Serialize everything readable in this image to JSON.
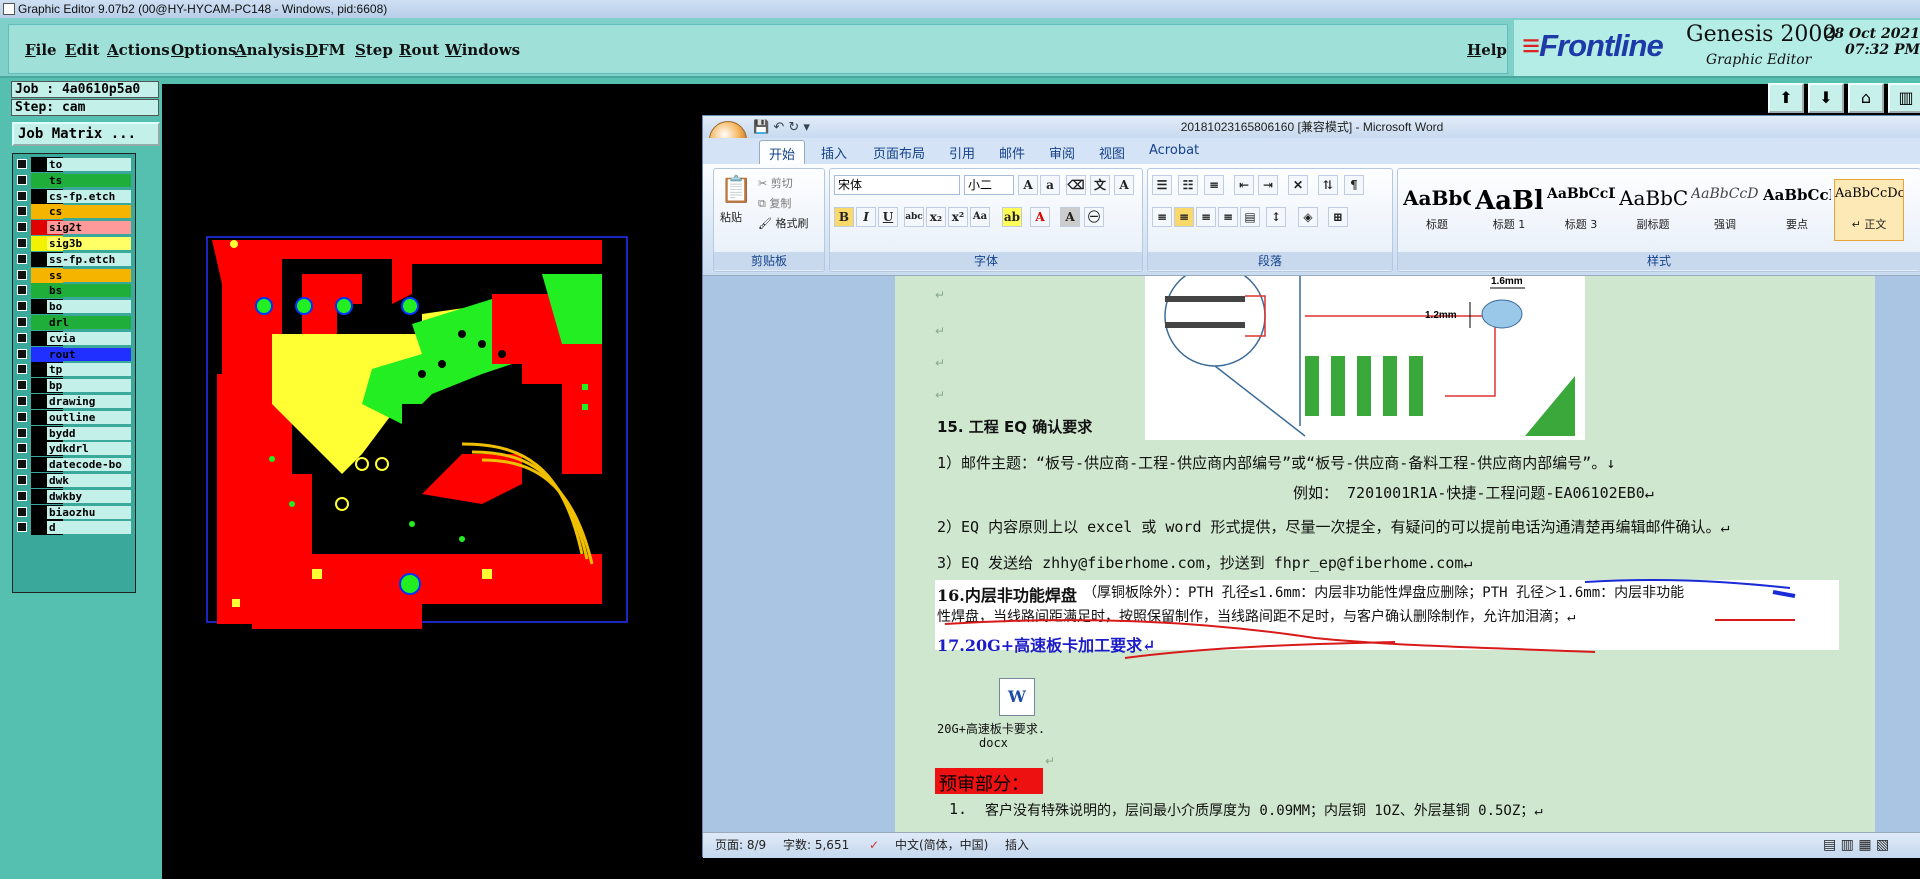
{
  "window_title": "Graphic Editor 9.07b2 (00@HY-HYCAM-PC148 - Windows, pid:6608)",
  "menu": [
    "File",
    "Edit",
    "Actions",
    "Options",
    "Analysis",
    "DFM",
    "Step",
    "Rout",
    "Windows"
  ],
  "help": "Help",
  "brand": {
    "logo": "Frontline",
    "product": "Genesis 2000",
    "sub": "Graphic Editor",
    "date": "28 Oct 2021",
    "time": "07:32 PM"
  },
  "job": "Job : 4a0610p5a0",
  "step": "Step: cam",
  "job_matrix": "Job Matrix ...",
  "layers": [
    {
      "name": "to",
      "color": "#000000"
    },
    {
      "name": "ts",
      "color": "#1fae3a"
    },
    {
      "name": "cs-fp.etch",
      "color": ""
    },
    {
      "name": "cs",
      "color": "#f5b400"
    },
    {
      "name": "sig2t",
      "color": "#e00000"
    },
    {
      "name": "sig3b",
      "color": "#f2f200"
    },
    {
      "name": "ss-fp.etch",
      "color": ""
    },
    {
      "name": "ss",
      "color": "#f5b400"
    },
    {
      "name": "bs",
      "color": "#1fae3a"
    },
    {
      "name": "bo",
      "color": "#000000"
    },
    {
      "name": "drl",
      "color": "#1fae3a"
    },
    {
      "name": "cvia",
      "color": ""
    },
    {
      "name": "rout",
      "color": "#2030ff"
    },
    {
      "name": "tp",
      "color": ""
    },
    {
      "name": "bp",
      "color": ""
    },
    {
      "name": "drawing",
      "color": ""
    },
    {
      "name": "outline",
      "color": ""
    },
    {
      "name": "bydd",
      "color": ""
    },
    {
      "name": "ydkdrl",
      "color": ""
    },
    {
      "name": "datecode-bo",
      "color": ""
    },
    {
      "name": "dwk",
      "color": ""
    },
    {
      "name": "dwkby",
      "color": ""
    },
    {
      "name": "biaozhu",
      "color": ""
    },
    {
      "name": "d",
      "color": ""
    }
  ],
  "word": {
    "title": "20181023165806160 [兼容模式] - Microsoft Word",
    "tabs": [
      "开始",
      "插入",
      "页面布局",
      "引用",
      "邮件",
      "审阅",
      "视图",
      "Acrobat"
    ],
    "clipboard": {
      "paste": "粘贴",
      "cut": "剪切",
      "copy": "复制",
      "painter": "格式刷",
      "label": "剪贴板"
    },
    "font": {
      "name": "宋体",
      "size": "小二",
      "label": "字体"
    },
    "paragraph_label": "段落",
    "styles_label": "样式",
    "styles": [
      {
        "preview": "AaBbC",
        "label": "标题"
      },
      {
        "preview": "AaBl",
        "label": "标题 1"
      },
      {
        "preview": "AaBbCcD",
        "label": "标题 3"
      },
      {
        "preview": "AaBbC",
        "label": "副标题"
      },
      {
        "preview": "AaBbCcDa",
        "label": "强调"
      },
      {
        "preview": "AaBbCcD",
        "label": "要点"
      },
      {
        "preview": "AaBbCcDc",
        "label": "↵ 正文"
      }
    ],
    "doc": {
      "fig_dim1": "1.6mm",
      "fig_dim2": "1.2mm",
      "h15": "15. 工程 EQ 确认要求",
      "l1": "1）邮件主题：“板号-供应商-工程-供应商内部编号”或“板号-供应商-备料工程-供应商内部编号”。↓",
      "l2": "例如：        7201001R1A-快捷-工程问题-EA06102EB0↵",
      "l3": "2）EQ 内容原则上以 excel 或 word 形式提供，尽量一次提全，有疑问的可以提前电话沟通清楚再编辑邮件确认。↵",
      "l4": "3）EQ 发送给 zhhy@fiberhome.com，抄送到 fhpr_ep@fiberhome.com↵",
      "h16": "16.内层非功能焊盘",
      "l16a": "（厚铜板除外）：PTH 孔径≤1.6mm：内层非功能性焊盘应删除；PTH 孔径＞1.6mm：内层非功能",
      "l16b": "性焊盘，当线路间距满足时，按照保留制作，当线路间距不足时，与客户确认删除制作，允许加泪滴；↵",
      "h17": "17.20G+高速板卡加工要求↵",
      "att1": "20G+高速板卡要求.",
      "att2": "docx",
      "pre": "预审部分：",
      "item1_num": "1.",
      "item1": "客户没有特殊说明的，层间最小介质厚度为 0.09MM；内层铜 1OZ、外层基铜 0.5OZ；↵"
    },
    "status": {
      "page": "页面: 8/9",
      "words": "字数: 5,651",
      "lang": "中文(简体，中国)",
      "mode": "插入"
    }
  }
}
